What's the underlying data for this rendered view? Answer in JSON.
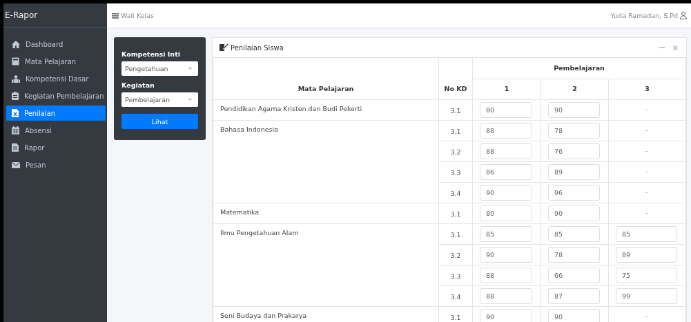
{
  "brand": "E-Rapor",
  "topbar": {
    "menu_label": "Wali Kelas",
    "user": "Yuda Ramadan, S.Pd"
  },
  "sidebar": {
    "items": [
      {
        "label": "Dashboard",
        "selected": false
      },
      {
        "label": "Mata Pelajaran",
        "selected": false
      },
      {
        "label": "Kompetensi Dasar",
        "selected": false
      },
      {
        "label": "Kegiatan Pembelajaran",
        "selected": false
      },
      {
        "label": "Penilaian",
        "selected": true
      },
      {
        "label": "Absensi",
        "selected": false
      },
      {
        "label": "Rapor",
        "selected": false
      },
      {
        "label": "Pesan",
        "selected": false
      }
    ]
  },
  "filter": {
    "fields": [
      {
        "label": "Kompetensi Inti",
        "value": "Pengetahuan"
      },
      {
        "label": "Kegiatan",
        "value": "Pembelajaran"
      }
    ],
    "button": "Lihat"
  },
  "card": {
    "title": "Penilaian Siswa",
    "columns": {
      "subject": "Mata Pelajaran",
      "kd": "No KD",
      "group": "Pembelajaran",
      "numbers": [
        "1",
        "2",
        "3"
      ]
    },
    "rows": [
      {
        "subject": "Pendidikan Agama Kristen dan Budi Pekerti",
        "kds": [
          {
            "kd": "3.1",
            "scores": [
              {
                "kind": "input",
                "value": "80"
              },
              {
                "kind": "input",
                "value": "90"
              },
              {
                "kind": "empty",
                "text": "-"
              }
            ]
          }
        ]
      },
      {
        "subject": "Bahasa Indonesia",
        "kds": [
          {
            "kd": "3.1",
            "scores": [
              {
                "kind": "input",
                "value": "88"
              },
              {
                "kind": "input",
                "value": "78"
              },
              {
                "kind": "empty",
                "text": "-"
              }
            ]
          },
          {
            "kd": "3.2",
            "scores": [
              {
                "kind": "input",
                "value": "88"
              },
              {
                "kind": "input",
                "value": "76"
              },
              {
                "kind": "empty",
                "text": "-"
              }
            ]
          },
          {
            "kd": "3.3",
            "scores": [
              {
                "kind": "input",
                "value": "86"
              },
              {
                "kind": "input",
                "value": "89"
              },
              {
                "kind": "empty",
                "text": "-"
              }
            ]
          },
          {
            "kd": "3.4",
            "scores": [
              {
                "kind": "input",
                "value": "90"
              },
              {
                "kind": "input",
                "value": "96"
              },
              {
                "kind": "empty",
                "text": "-"
              }
            ]
          }
        ]
      },
      {
        "subject": "Matematika",
        "kds": [
          {
            "kd": "3.1",
            "scores": [
              {
                "kind": "input",
                "value": "80"
              },
              {
                "kind": "input",
                "value": "90"
              },
              {
                "kind": "empty",
                "text": "-"
              }
            ]
          }
        ]
      },
      {
        "subject": "Ilmu Pengetahuan Alam",
        "kds": [
          {
            "kd": "3.1",
            "scores": [
              {
                "kind": "input",
                "value": "85"
              },
              {
                "kind": "input",
                "value": "85"
              },
              {
                "kind": "input",
                "value": "85"
              }
            ]
          },
          {
            "kd": "3.2",
            "scores": [
              {
                "kind": "input",
                "value": "90"
              },
              {
                "kind": "input",
                "value": "78"
              },
              {
                "kind": "input",
                "value": "89"
              }
            ]
          },
          {
            "kd": "3.3",
            "scores": [
              {
                "kind": "input",
                "value": "88"
              },
              {
                "kind": "input",
                "value": "66"
              },
              {
                "kind": "input",
                "value": "75"
              }
            ]
          },
          {
            "kd": "3.4",
            "scores": [
              {
                "kind": "input",
                "value": "88"
              },
              {
                "kind": "input",
                "value": "87"
              },
              {
                "kind": "input",
                "value": "99"
              }
            ]
          }
        ]
      },
      {
        "subject": "Seni Budaya dan Prakarya",
        "kds": [
          {
            "kd": "3.1",
            "scores": [
              {
                "kind": "input",
                "value": "90"
              },
              {
                "kind": "input",
                "value": "90"
              },
              {
                "kind": "empty",
                "text": "-"
              }
            ]
          }
        ]
      }
    ]
  }
}
